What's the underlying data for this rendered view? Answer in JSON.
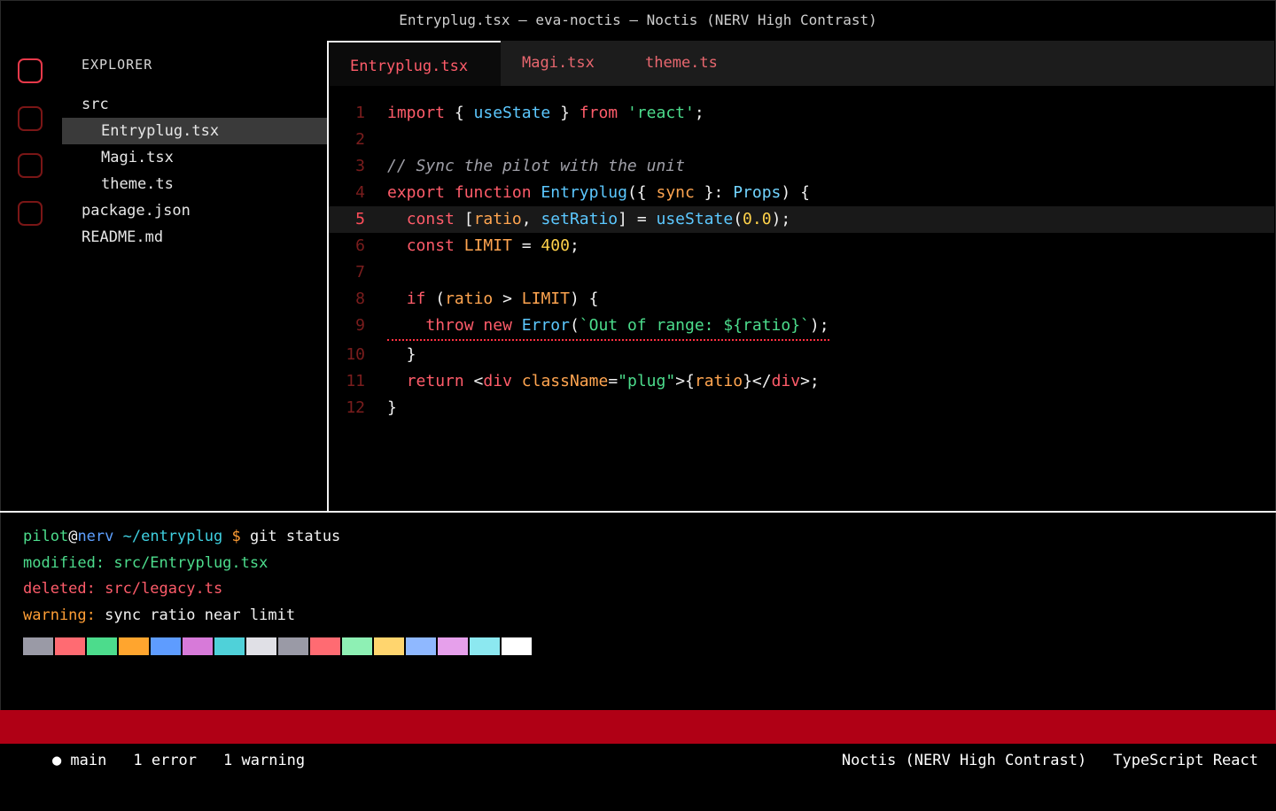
{
  "window": {
    "title": "Entryplug.tsx — eva-noctis — Noctis (NERV High Contrast)"
  },
  "activity_bar": {
    "items": [
      "explorer-icon",
      "search-icon",
      "source-control-icon",
      "extensions-icon"
    ]
  },
  "sidebar": {
    "title": "EXPLORER",
    "tree": [
      {
        "label": "src",
        "level": 0
      },
      {
        "label": "Entryplug.tsx",
        "level": 1,
        "selected": true
      },
      {
        "label": "Magi.tsx",
        "level": 1
      },
      {
        "label": "theme.ts",
        "level": 1
      },
      {
        "label": "package.json",
        "level": 0
      },
      {
        "label": "README.md",
        "level": 0
      }
    ]
  },
  "tabs": [
    {
      "label": "Entryplug.tsx",
      "active": true
    },
    {
      "label": "Magi.tsx",
      "active": false
    },
    {
      "label": "theme.ts",
      "active": false
    }
  ],
  "editor": {
    "current_line": 5,
    "lines": [
      {
        "n": "1",
        "tokens": [
          [
            "kw",
            "import"
          ],
          [
            "p",
            " { "
          ],
          [
            "fn",
            "useState"
          ],
          [
            "p",
            " } "
          ],
          [
            "kw",
            "from"
          ],
          [
            "p",
            " "
          ],
          [
            "str",
            "'react'"
          ],
          [
            "p",
            ";"
          ]
        ]
      },
      {
        "n": "2",
        "tokens": []
      },
      {
        "n": "3",
        "tokens": [
          [
            "cmt",
            "// Sync the pilot with the unit"
          ]
        ]
      },
      {
        "n": "4",
        "tokens": [
          [
            "kw",
            "export"
          ],
          [
            "p",
            " "
          ],
          [
            "kw",
            "function"
          ],
          [
            "p",
            " "
          ],
          [
            "fn",
            "Entryplug"
          ],
          [
            "p",
            "({ "
          ],
          [
            "var",
            "sync"
          ],
          [
            "p",
            " }: "
          ],
          [
            "typ",
            "Props"
          ],
          [
            "p",
            ") {"
          ]
        ]
      },
      {
        "n": "5",
        "tokens": [
          [
            "p",
            "  "
          ],
          [
            "kw",
            "const"
          ],
          [
            "p",
            " ["
          ],
          [
            "var",
            "ratio"
          ],
          [
            "p",
            ", "
          ],
          [
            "fn",
            "setRatio"
          ],
          [
            "p",
            "] = "
          ],
          [
            "fn",
            "useState"
          ],
          [
            "p",
            "("
          ],
          [
            "num",
            "0.0"
          ],
          [
            "p",
            ");"
          ]
        ]
      },
      {
        "n": "6",
        "tokens": [
          [
            "p",
            "  "
          ],
          [
            "kw",
            "const"
          ],
          [
            "p",
            " "
          ],
          [
            "var",
            "LIMIT"
          ],
          [
            "p",
            " = "
          ],
          [
            "num",
            "400"
          ],
          [
            "p",
            ";"
          ]
        ]
      },
      {
        "n": "7",
        "tokens": []
      },
      {
        "n": "8",
        "tokens": [
          [
            "p",
            "  "
          ],
          [
            "kw",
            "if"
          ],
          [
            "p",
            " ("
          ],
          [
            "var",
            "ratio"
          ],
          [
            "p",
            " > "
          ],
          [
            "var",
            "LIMIT"
          ],
          [
            "p",
            ") {"
          ]
        ]
      },
      {
        "n": "9",
        "error": true,
        "tokens": [
          [
            "p",
            "    "
          ],
          [
            "kw",
            "throw"
          ],
          [
            "p",
            " "
          ],
          [
            "kw",
            "new"
          ],
          [
            "p",
            " "
          ],
          [
            "fn",
            "Error"
          ],
          [
            "p",
            "("
          ],
          [
            "str",
            "`Out of range: ${ratio}`"
          ],
          [
            "p",
            ");"
          ]
        ]
      },
      {
        "n": "10",
        "tokens": [
          [
            "p",
            "  }"
          ]
        ]
      },
      {
        "n": "11",
        "tokens": [
          [
            "p",
            "  "
          ],
          [
            "kw",
            "return"
          ],
          [
            "p",
            " <"
          ],
          [
            "kw",
            "div"
          ],
          [
            "p",
            " "
          ],
          [
            "var",
            "className"
          ],
          [
            "p",
            "="
          ],
          [
            "str",
            "\"plug\""
          ],
          [
            "p",
            ">{"
          ],
          [
            "var",
            "ratio"
          ],
          [
            "p",
            "}</"
          ],
          [
            "kw",
            "div"
          ],
          [
            "p",
            ">;"
          ]
        ]
      },
      {
        "n": "12",
        "tokens": [
          [
            "p",
            "}"
          ]
        ]
      }
    ]
  },
  "terminal": {
    "prompt": {
      "user": "pilot",
      "at": "@",
      "host": "nerv",
      "path": " ~/entryplug",
      "symbol": " $",
      "command": " git status"
    },
    "lines": [
      {
        "label": "modified: ",
        "text": "src/Entryplug.tsx",
        "color": "green"
      },
      {
        "label": "deleted: ",
        "text": "src/legacy.ts",
        "color": "red"
      },
      {
        "label": "warning: ",
        "text": "sync ratio near limit",
        "color": "orange"
      }
    ],
    "palette": [
      "#9a9aa6",
      "#ff6b72",
      "#4cdc8c",
      "#ffa52e",
      "#5e9cff",
      "#d77ad9",
      "#4fd1d9",
      "#e0e0e6",
      "#9a9aa6",
      "#ff6b72",
      "#8ef0b4",
      "#ffd56e",
      "#8fb8ff",
      "#e6a0eb",
      "#8ce8f0",
      "#ffffff"
    ]
  },
  "statusbar": {
    "branch": "● main",
    "errors": "1 error",
    "warnings": "1 warning",
    "theme": "Noctis (NERV High Contrast)",
    "language": "TypeScript React"
  },
  "colors": {
    "accent": "#b00015",
    "keyword": "#ff5c6a",
    "function": "#5cc8ff",
    "string": "#4cdc8c",
    "variable": "#ffa550",
    "number": "#ffd24a"
  }
}
